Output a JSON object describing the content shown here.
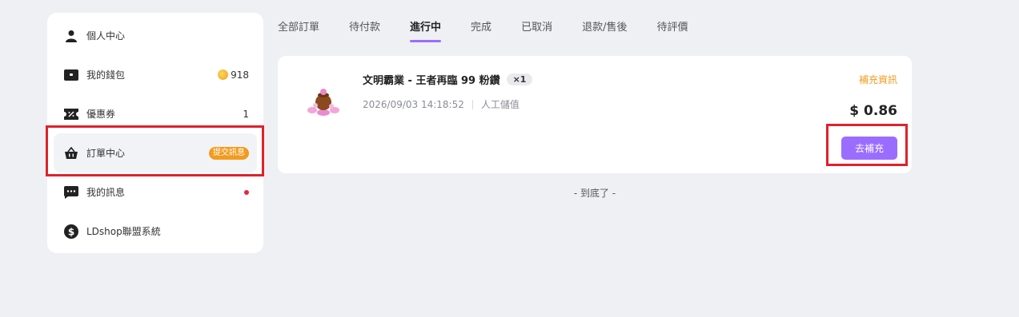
{
  "sidebar": {
    "items": [
      {
        "label": "個人中心",
        "icon": "user-icon"
      },
      {
        "label": "我的錢包",
        "icon": "wallet-icon",
        "value": "918"
      },
      {
        "label": "優惠券",
        "icon": "coupon-icon",
        "value": "1"
      },
      {
        "label": "訂單中心",
        "icon": "basket-icon",
        "badge": "提交訊息",
        "active": true
      },
      {
        "label": "我的訊息",
        "icon": "chat-icon",
        "has_dot": true
      },
      {
        "label": "LDshop聯盟系統",
        "icon": "dollar-icon"
      }
    ]
  },
  "tabs": [
    {
      "label": "全部訂單"
    },
    {
      "label": "待付款"
    },
    {
      "label": "進行中",
      "active": true
    },
    {
      "label": "完成"
    },
    {
      "label": "已取消"
    },
    {
      "label": "退款/售後"
    },
    {
      "label": "待評價"
    }
  ],
  "order": {
    "title": "文明霸業 - 王者再臨 99 粉鑽",
    "quantity": "×1",
    "datetime": "2026/09/03 14:18:52",
    "method": "人工儲值",
    "info_link": "補充資訊",
    "price": "$ 0.86",
    "action_button": "去補充"
  },
  "footer": {
    "end_text": "- 到底了 -"
  },
  "colors": {
    "accent": "#9b6dff",
    "orange": "#f39b1f",
    "highlight": "#e0212b",
    "background": "#eef0f4"
  }
}
